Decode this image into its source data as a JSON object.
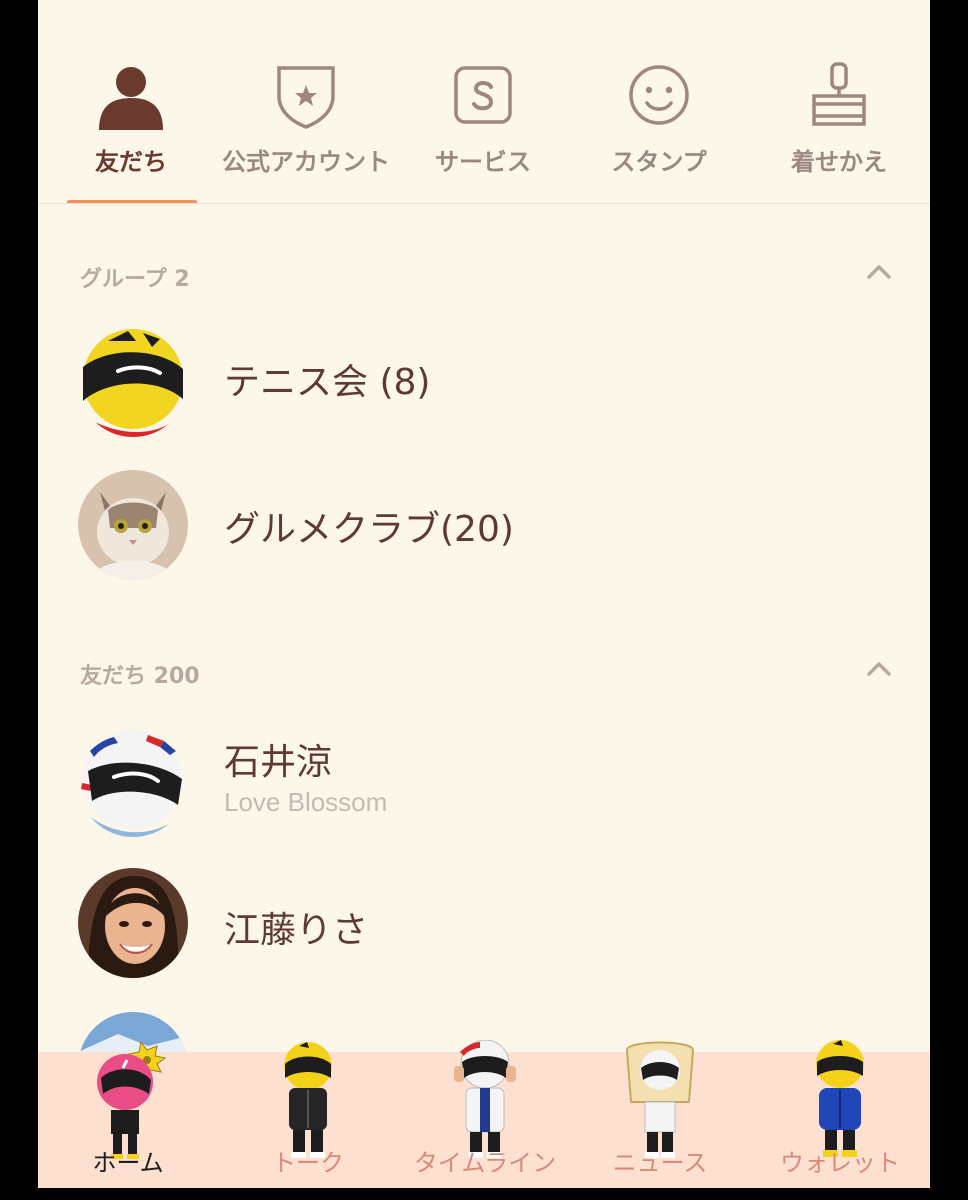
{
  "top_tabs": [
    {
      "label": "友だち",
      "icon": "person-icon",
      "active": true
    },
    {
      "label": "公式アカウント",
      "icon": "badge-star-icon",
      "active": false
    },
    {
      "label": "サービス",
      "icon": "service-s-icon",
      "active": false
    },
    {
      "label": "スタンプ",
      "icon": "smiley-icon",
      "active": false
    },
    {
      "label": "着せかえ",
      "icon": "brush-icon",
      "active": false
    }
  ],
  "groups": {
    "header": "グループ 2",
    "items": [
      {
        "name": "テニス会 (8)",
        "avatar": "helmet-yellow-avatar"
      },
      {
        "name": "グルメクラブ(20)",
        "avatar": "cat-avatar"
      }
    ]
  },
  "friends": {
    "header": "友だち 200",
    "items": [
      {
        "name": "石井涼",
        "status": "Love Blossom",
        "avatar": "helmet-white-avatar"
      },
      {
        "name": "江藤りさ",
        "status": "",
        "avatar": "woman-photo-avatar"
      },
      {
        "name": "",
        "status": "",
        "avatar": "landscape-avatar"
      }
    ]
  },
  "bottom_nav": [
    {
      "label": "ホーム",
      "active": true,
      "icon": "helmet-pink-character-icon"
    },
    {
      "label": "トーク",
      "active": false,
      "icon": "helmet-yellow-character-icon"
    },
    {
      "label": "タイムライン",
      "active": false,
      "icon": "helmet-white-character-icon"
    },
    {
      "label": "ニュース",
      "active": false,
      "icon": "helmet-toast-character-icon"
    },
    {
      "label": "ウォレット",
      "active": false,
      "icon": "helmet-blue-character-icon"
    }
  ],
  "colors": {
    "background": "#fdf7e9",
    "accent": "#f0915a",
    "text_primary": "#5e3a33",
    "bottom_nav_bg": "#fde0cf"
  }
}
